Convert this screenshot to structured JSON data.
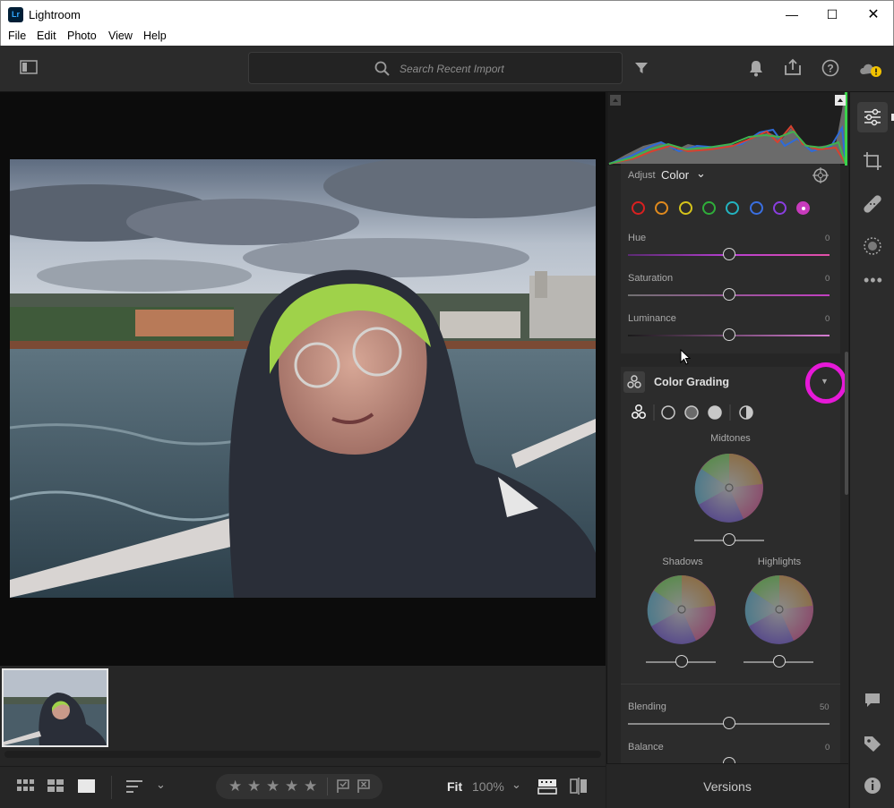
{
  "window": {
    "title": "Lightroom",
    "logo": "Lr",
    "controls": [
      "minimize-icon",
      "maximize-icon",
      "close-icon"
    ]
  },
  "menu": [
    "File",
    "Edit",
    "Photo",
    "View",
    "Help"
  ],
  "topbar": {
    "search_placeholder": "Search Recent Import"
  },
  "adjust": {
    "label": "Adjust",
    "mode": "Color",
    "swatches": [
      "#d92020",
      "#e08a1e",
      "#d6c41b",
      "#2fae3a",
      "#23b4c0",
      "#3a6fe0",
      "#8a3ee0",
      "#c83bbd"
    ],
    "sliders": [
      {
        "label": "Hue",
        "value": "0"
      },
      {
        "label": "Saturation",
        "value": "0"
      },
      {
        "label": "Luminance",
        "value": "0"
      }
    ]
  },
  "color_grading": {
    "title": "Color Grading",
    "midtones": "Midtones",
    "shadows": "Shadows",
    "highlights": "Highlights",
    "blending": {
      "label": "Blending",
      "value": "50"
    },
    "balance": {
      "label": "Balance",
      "value": "0"
    }
  },
  "bottom": {
    "fit": "Fit",
    "zoom": "100%"
  },
  "versions": "Versions",
  "colors": {
    "accent_annotation": "#e619d8",
    "panel": "#262626"
  }
}
